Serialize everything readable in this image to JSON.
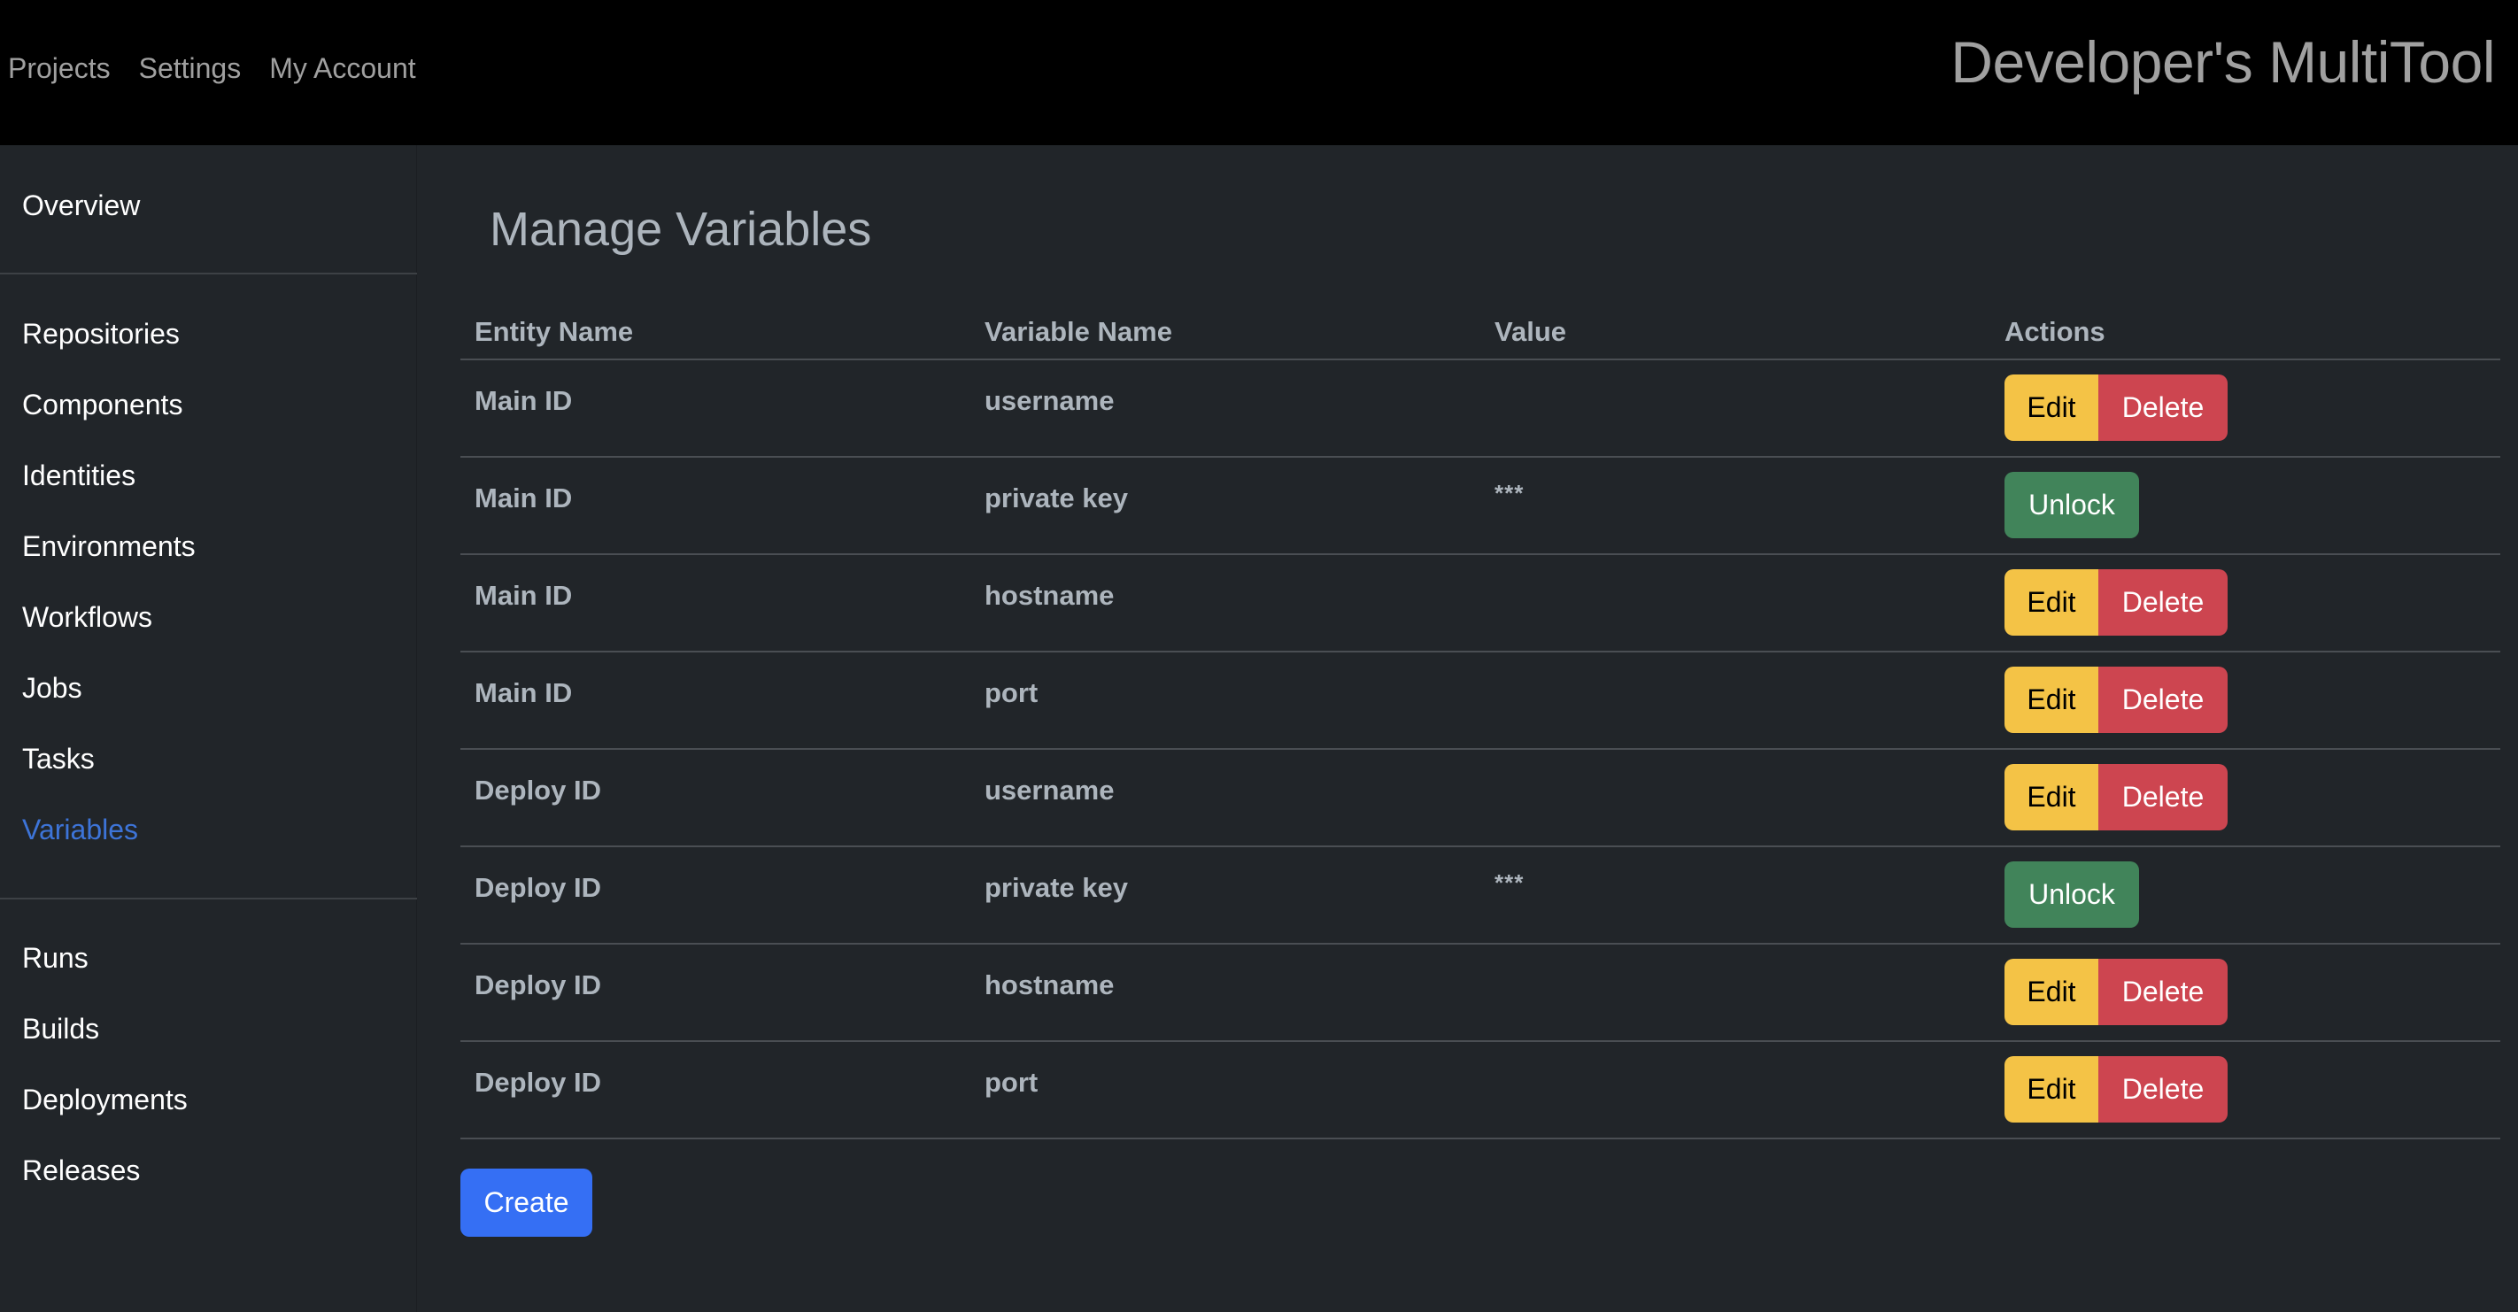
{
  "topbar": {
    "nav": [
      "Projects",
      "Settings",
      "My Account"
    ],
    "brand": "Developer's MultiTool"
  },
  "sidebar": {
    "groups": [
      [
        {
          "label": "Overview",
          "active": false
        }
      ],
      [
        {
          "label": "Repositories",
          "active": false
        },
        {
          "label": "Components",
          "active": false
        },
        {
          "label": "Identities",
          "active": false
        },
        {
          "label": "Environments",
          "active": false
        },
        {
          "label": "Workflows",
          "active": false
        },
        {
          "label": "Jobs",
          "active": false
        },
        {
          "label": "Tasks",
          "active": false
        },
        {
          "label": "Variables",
          "active": true
        }
      ],
      [
        {
          "label": "Runs",
          "active": false
        },
        {
          "label": "Builds",
          "active": false
        },
        {
          "label": "Deployments",
          "active": false
        },
        {
          "label": "Releases",
          "active": false
        }
      ]
    ],
    "active_color": "#3d74d8"
  },
  "main": {
    "title": "Manage Variables",
    "table": {
      "columns": [
        "Entity Name",
        "Variable Name",
        "Value",
        "Actions"
      ],
      "rows": [
        {
          "entity": "Main ID",
          "variable": "username",
          "value": "",
          "locked": false
        },
        {
          "entity": "Main ID",
          "variable": "private key",
          "value": "***",
          "locked": true
        },
        {
          "entity": "Main ID",
          "variable": "hostname",
          "value": "",
          "locked": false
        },
        {
          "entity": "Main ID",
          "variable": "port",
          "value": "",
          "locked": false
        },
        {
          "entity": "Deploy ID",
          "variable": "username",
          "value": "",
          "locked": false
        },
        {
          "entity": "Deploy ID",
          "variable": "private key",
          "value": "***",
          "locked": true
        },
        {
          "entity": "Deploy ID",
          "variable": "hostname",
          "value": "",
          "locked": false
        },
        {
          "entity": "Deploy ID",
          "variable": "port",
          "value": "",
          "locked": false
        }
      ]
    },
    "actions": {
      "edit_label": "Edit",
      "delete_label": "Delete",
      "unlock_label": "Unlock",
      "create_label": "Create"
    },
    "colors": {
      "edit": "#f4c346",
      "delete": "#cd4550",
      "unlock": "#41845a",
      "create": "#356ff4"
    }
  }
}
